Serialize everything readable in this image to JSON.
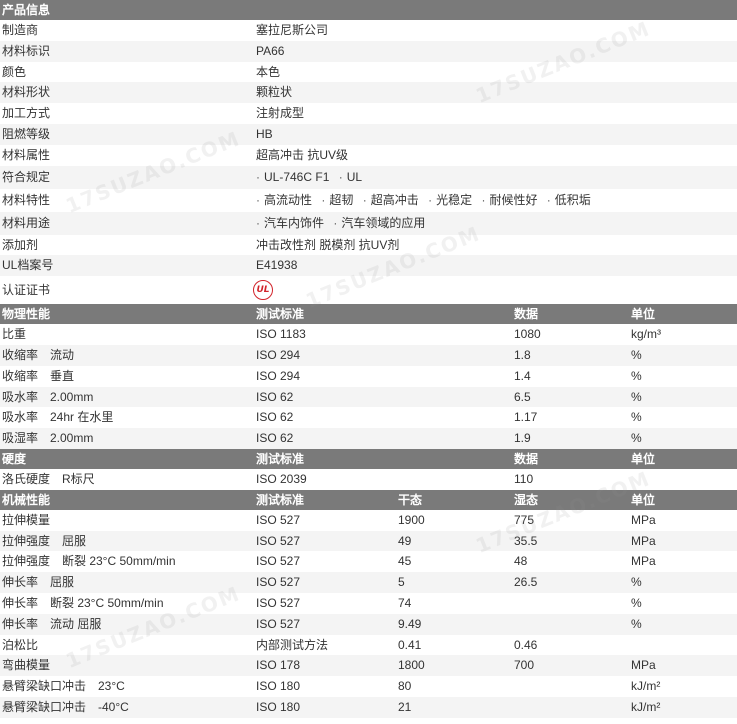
{
  "watermark": "17SUZAO.COM",
  "product_info": {
    "header": "产品信息",
    "rows": [
      {
        "label": "制造商",
        "value": "塞拉尼斯公司"
      },
      {
        "label": "材料标识",
        "value": "PA66"
      },
      {
        "label": "颜色",
        "value": "本色"
      },
      {
        "label": "材料形状",
        "value": "颗粒状"
      },
      {
        "label": "加工方式",
        "value": "注射成型"
      },
      {
        "label": "阻燃等级",
        "value": "HB"
      },
      {
        "label": "材料属性",
        "value": "超高冲击 抗UV级"
      }
    ],
    "compliance": {
      "label": "符合规定",
      "tags": [
        "UL-746C F1",
        "UL"
      ]
    },
    "features": {
      "label": "材料特性",
      "tags": [
        "高流动性",
        "超韧",
        "超高冲击",
        "光稳定",
        "耐候性好",
        "低积垢"
      ]
    },
    "uses": {
      "label": "材料用途",
      "tags": [
        "汽车内饰件",
        "汽车领域的应用"
      ]
    },
    "additive": {
      "label": "添加剂",
      "value": "冲击改性剂 脱模剂 抗UV剂"
    },
    "ul_file": {
      "label": "UL档案号",
      "value": "E41938"
    },
    "cert": {
      "label": "认证证书",
      "logo_text": "UL",
      "logo_color": "#d2232a"
    }
  },
  "physical": {
    "header": {
      "name": "物理性能",
      "standard": "测试标准",
      "data": "数据",
      "unit": "单位"
    },
    "rows": [
      {
        "name": "比重",
        "standard": "ISO 1183",
        "data": "1080",
        "unit": "kg/m³"
      },
      {
        "name": "收缩率　流动",
        "standard": "ISO 294",
        "data": "1.8",
        "unit": "%"
      },
      {
        "name": "收缩率　垂直",
        "standard": "ISO 294",
        "data": "1.4",
        "unit": "%"
      },
      {
        "name": "吸水率　2.00mm",
        "standard": "ISO 62",
        "data": "6.5",
        "unit": "%"
      },
      {
        "name": "吸水率　24hr 在水里",
        "standard": "ISO 62",
        "data": "1.17",
        "unit": "%"
      },
      {
        "name": "吸湿率　2.00mm",
        "standard": "ISO 62",
        "data": "1.9",
        "unit": "%"
      }
    ]
  },
  "hardness": {
    "header": {
      "name": "硬度",
      "standard": "测试标准",
      "data": "数据",
      "unit": "单位"
    },
    "rows": [
      {
        "name": "洛氏硬度　R标尺",
        "standard": "ISO 2039",
        "data": "110",
        "unit": ""
      }
    ]
  },
  "mechanical": {
    "header": {
      "name": "机械性能",
      "standard": "测试标准",
      "dry": "干态",
      "wet": "湿态",
      "unit": "单位"
    },
    "rows": [
      {
        "name": "拉伸模量",
        "standard": "ISO 527",
        "dry": "1900",
        "wet": "775",
        "unit": "MPa"
      },
      {
        "name": "拉伸强度　屈服",
        "standard": "ISO 527",
        "dry": "49",
        "wet": "35.5",
        "unit": "MPa"
      },
      {
        "name": "拉伸强度　断裂 23°C 50mm/min",
        "standard": "ISO 527",
        "dry": "45",
        "wet": "48",
        "unit": "MPa"
      },
      {
        "name": "伸长率　屈服",
        "standard": "ISO 527",
        "dry": "5",
        "wet": "26.5",
        "unit": "%"
      },
      {
        "name": "伸长率　断裂 23°C 50mm/min",
        "standard": "ISO 527",
        "dry": "74",
        "wet": "",
        "unit": "%"
      },
      {
        "name": "伸长率　流动 屈服",
        "standard": "ISO 527",
        "dry": "9.49",
        "wet": "",
        "unit": "%"
      },
      {
        "name": "泊松比",
        "standard": "内部测试方法",
        "dry": "0.41",
        "wet": "0.46",
        "unit": ""
      },
      {
        "name": "弯曲模量",
        "standard": "ISO 178",
        "dry": "1800",
        "wet": "700",
        "unit": "MPa"
      },
      {
        "name": "悬臂梁缺口冲击　23°C",
        "standard": "ISO 180",
        "dry": "80",
        "wet": "",
        "unit": "kJ/m²"
      },
      {
        "name": "悬臂梁缺口冲击　-40°C",
        "standard": "ISO 180",
        "dry": "21",
        "wet": "",
        "unit": "kJ/m²"
      }
    ]
  }
}
